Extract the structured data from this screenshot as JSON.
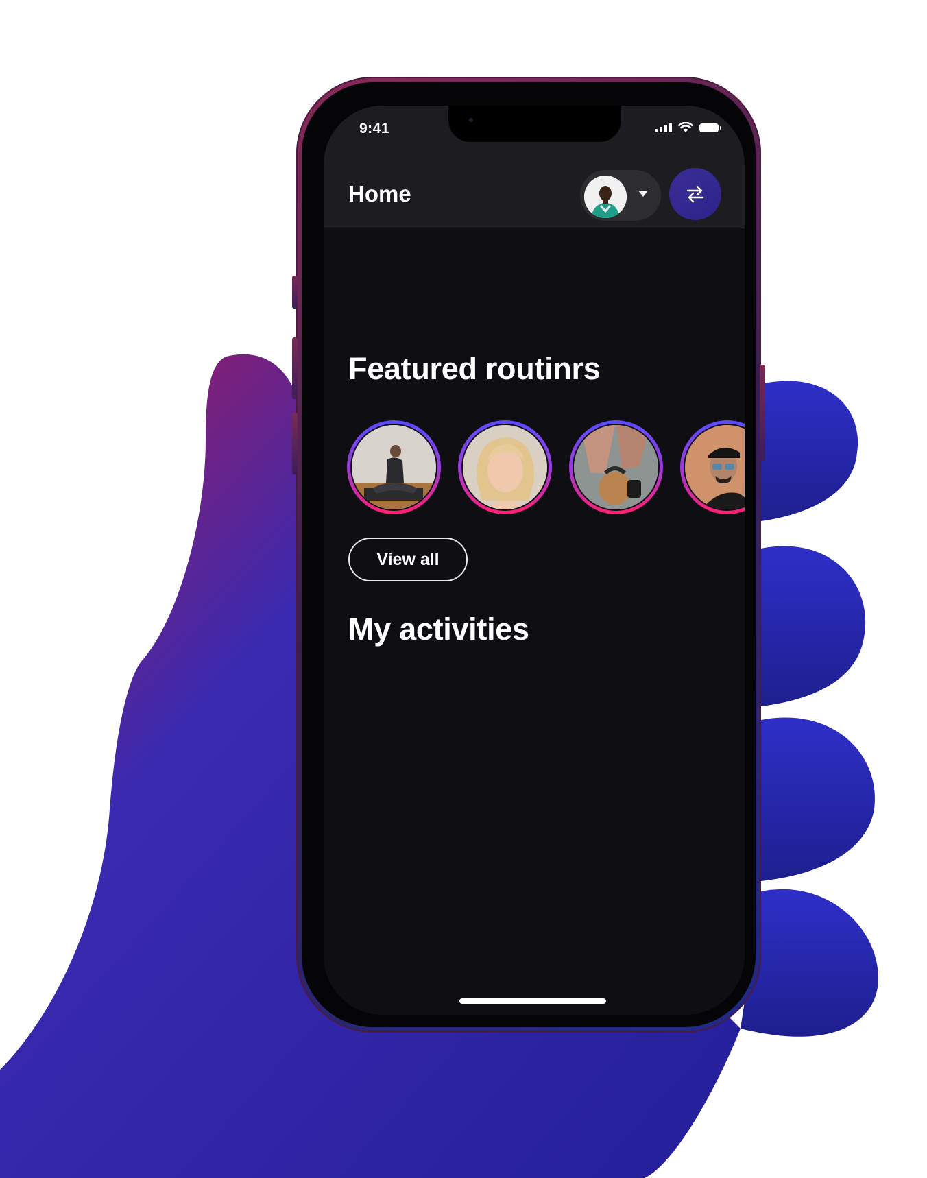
{
  "status_bar": {
    "time": "9:41"
  },
  "header": {
    "title": "Home"
  },
  "featured": {
    "title": "Featured routinrs",
    "items": [
      "yoga-routine",
      "portrait-woman",
      "kettlebell-routine",
      "portrait-man-sunglasses"
    ],
    "view_all_label": "View all"
  },
  "activities": {
    "title": "My activities"
  },
  "colors": {
    "screen_bg": "#0e0e13",
    "header_bg": "#1c1c21",
    "accent": "#2f2690",
    "ring_top": "#5a4bff",
    "ring_bottom": "#ff1f70"
  }
}
